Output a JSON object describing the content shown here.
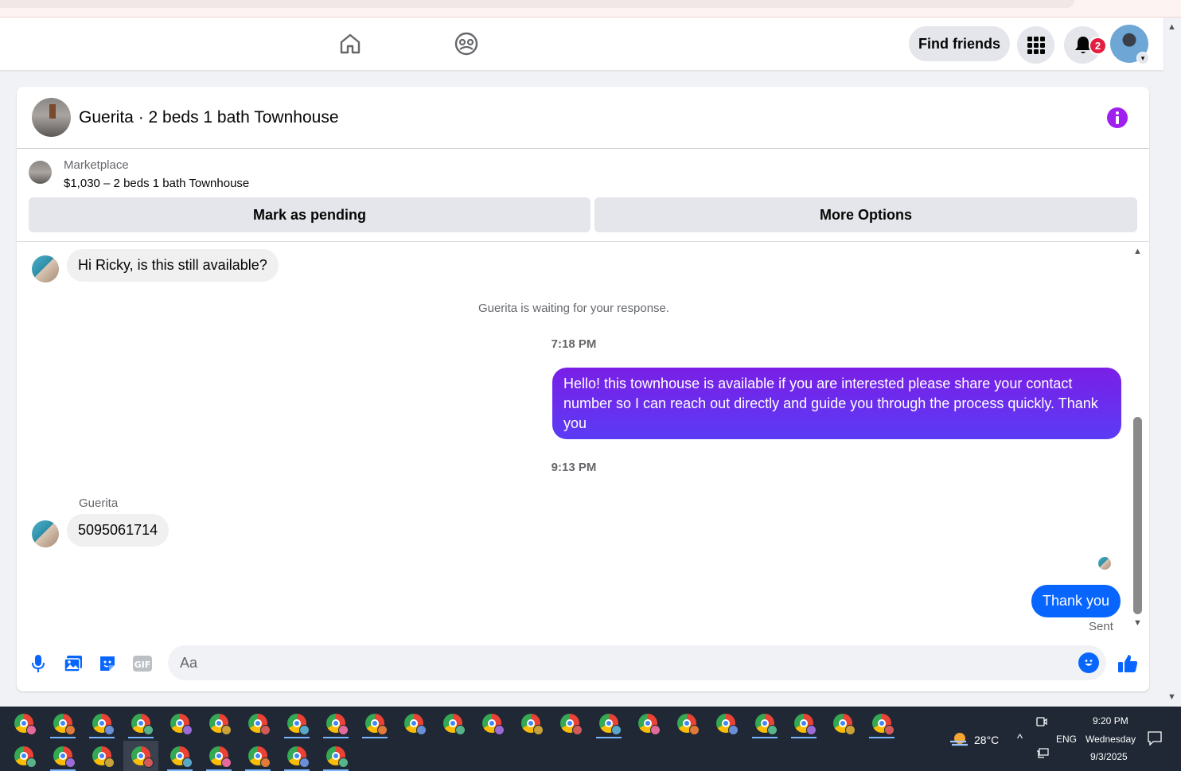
{
  "topnav": {
    "find_friends_label": "Find friends",
    "notification_count": "2"
  },
  "conversation": {
    "title": "Guerita · 2 beds 1 bath Townhouse",
    "marketplace_label": "Marketplace",
    "listing_summary": "$1,030 – 2 beds 1 bath Townhouse",
    "mark_pending_label": "Mark as pending",
    "more_options_label": "More Options"
  },
  "messages": {
    "incoming_1": "Hi Ricky, is this still available?",
    "waiting_note": "Guerita is waiting for your response.",
    "time_1": "7:18 PM",
    "outgoing_1": "Hello! this townhouse is available if you are interested please share your contact number so I can reach out directly and guide you through the process quickly. Thank you",
    "time_2": "9:13 PM",
    "sender_name": "Guerita",
    "incoming_2": "5095061714",
    "outgoing_2": "Thank you",
    "sent_status": "Sent"
  },
  "composer": {
    "placeholder": "Aa",
    "gif_label": "GIF"
  },
  "taskbar": {
    "weather": "28°C",
    "language": "ENG",
    "time": "9:20 PM",
    "day": "Wednesday",
    "date": "9/3/2025"
  },
  "colors": {
    "accent_blue": "#0866ff",
    "outgoing_gradient_start": "#7a1fe6",
    "outgoing_gradient_end": "#5b3bf5",
    "info_purple": "#a020f0",
    "badge_red": "#e41e3f"
  }
}
